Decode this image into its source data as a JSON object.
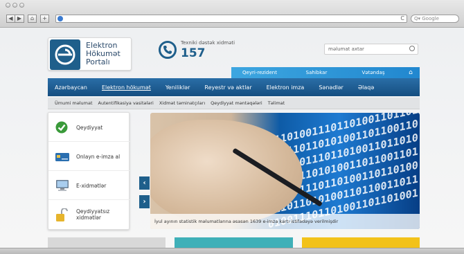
{
  "browser": {
    "search_placeholder": "Google",
    "back": "◀",
    "forward": "▶",
    "home": "⌂",
    "add": "+",
    "reload": "C"
  },
  "site": {
    "logo_lines": [
      "Elektron",
      "Hökumət",
      "Portalı"
    ],
    "support_label": "Texniki dəstək xidməti",
    "support_number": "157",
    "search_placeholder": "məlumat axtar"
  },
  "audience_tabs": [
    "Qeyri-rezident",
    "Sahibkar",
    "Vətəndaş"
  ],
  "audience_home": "⌂",
  "main_nav": [
    "Azərbaycan",
    "Elektron hökumət",
    "Yeniliklər",
    "Reyestr və aktlar",
    "Elektron imza",
    "Sənədlər",
    "Əlaqə"
  ],
  "sub_nav": [
    "Ümumi məlumat",
    "Autentifikasiya vasitələri",
    "Xidmət təminatçıları",
    "Qeydiyyat məntəqələri",
    "Təlimat"
  ],
  "quick_links": [
    {
      "label": "Qeydiyyat",
      "icon": "check-icon"
    },
    {
      "label": "Onlayn e-imza al",
      "icon": "card-icon"
    },
    {
      "label": "E-xidmətlər",
      "icon": "computer-icon"
    },
    {
      "label": "Qeydiyyatsız xidmətlər",
      "icon": "unlock-icon"
    }
  ],
  "slider": {
    "caption": "İyul ayının statistik məlumatlarına əsasən 1639 e-imza kartı istifadəyə verilmişdir",
    "binary": "01101001110110100110110100111011010100110110011011010011101101001101101001110110101001101100110110100111011010011011010011101101010011011001101101001110110100110110100111",
    "prev": "‹",
    "next": "›"
  },
  "colors": {
    "primary": "#1f5f8b",
    "accent": "#2187cf",
    "teal": "#3fb0b8",
    "yellow": "#f2c21a"
  }
}
